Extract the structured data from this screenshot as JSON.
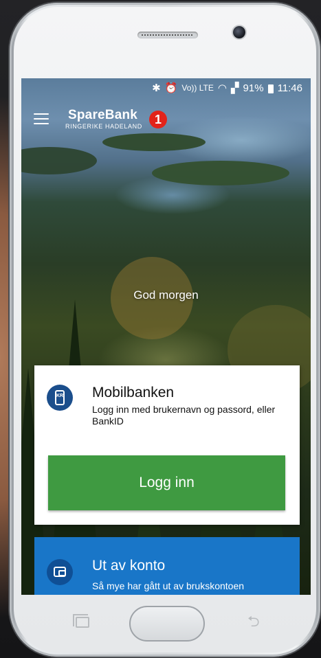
{
  "status_bar": {
    "icons": [
      "bluetooth-icon",
      "alarm-icon",
      "volte-icon",
      "wifi-icon",
      "signal-icon",
      "battery-icon"
    ],
    "volte_label": "Vo))",
    "lte_label": "LTE",
    "battery": "91%",
    "time": "11:46"
  },
  "app_bar": {
    "logo_main": "SpareBank",
    "logo_badge": "1",
    "logo_sub": "RINGERIKE HADELAND"
  },
  "greeting": "God morgen",
  "login_card": {
    "icon_label": "KR",
    "title": "Mobilbanken",
    "description": "Logg inn med brukernavn og passord, eller BankID",
    "button_label": "Logg inn",
    "button_color": "#3f9a41"
  },
  "account_card": {
    "title": "Ut av konto",
    "description": "Så mye har gått ut av brukskontoen",
    "color": "#1976c8"
  },
  "colors": {
    "brand_red": "#e2231a",
    "brand_navy": "#1b4e8c"
  }
}
